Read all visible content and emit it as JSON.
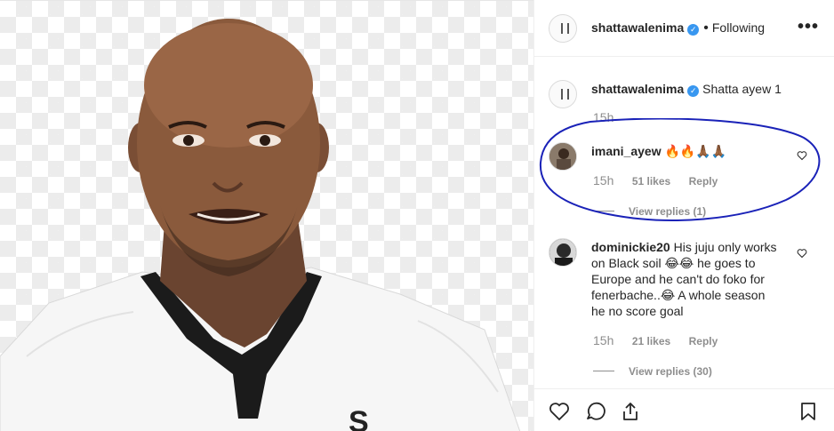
{
  "post": {
    "author": "shattawalenima",
    "follow_state": "Following",
    "caption_author": "shattawalenima",
    "caption": "Shatta ayew 1",
    "caption_time": "15h"
  },
  "comments": [
    {
      "user": "imani_ayew",
      "text": "🔥🔥🙏🏾🙏🏾",
      "time": "15h",
      "likes": "51 likes",
      "reply": "Reply",
      "view_replies": "View replies (1)"
    },
    {
      "user": "dominickie20",
      "text_line1": "His juju only works",
      "text_line2": "on Black soil 😂😂 he goes to",
      "text_line3": "Europe and he can't do foko for",
      "text_line4": "fenerbache..😂 A whole season",
      "text_line5": "he no score goal",
      "time": "15h",
      "likes": "21 likes",
      "reply": "Reply",
      "view_replies": "View replies (30)"
    }
  ],
  "icons": {
    "more": "more-options-icon",
    "like": "heart-icon",
    "comment": "comment-icon",
    "share": "share-icon",
    "save": "bookmark-icon",
    "verified": "verified-badge-icon"
  },
  "colors": {
    "verified": "#3897f0",
    "annotation_ring": "#1a22b8",
    "muted_text": "#8e8e8e"
  }
}
